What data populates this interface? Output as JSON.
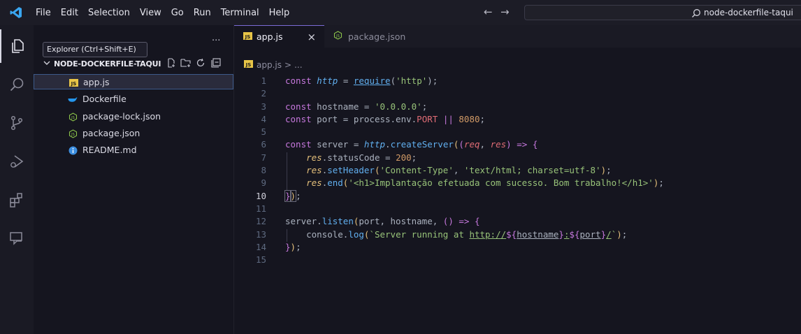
{
  "titlebar": {
    "menu": [
      "File",
      "Edit",
      "Selection",
      "View",
      "Go",
      "Run",
      "Terminal",
      "Help"
    ],
    "back_arrow": "←",
    "forward_arrow": "→",
    "search_text": "node-dockerfile-taqui"
  },
  "tooltip": "Explorer (Ctrl+Shift+E)",
  "sidebar": {
    "more_label": "···",
    "folder_name": "NODE-DOCKERFILE-TAQUI",
    "files": [
      {
        "name": "app.js",
        "icon": "js-icon"
      },
      {
        "name": "Dockerfile",
        "icon": "docker-icon"
      },
      {
        "name": "package-lock.json",
        "icon": "npm-icon"
      },
      {
        "name": "package.json",
        "icon": "npm-icon"
      },
      {
        "name": "README.md",
        "icon": "info-icon"
      }
    ]
  },
  "tabs": [
    {
      "label": "app.js",
      "badge": "JS",
      "close": "×"
    },
    {
      "label": "package.json",
      "badge": "⬡"
    }
  ],
  "breadcrumb": {
    "file": "app.js",
    "sep": ">",
    "rest": "..."
  },
  "editor": {
    "current_line": 10,
    "lines": [
      "const http = require('http');",
      "",
      "const hostname = '0.0.0.0';",
      "const port = process.env.PORT || 8080;",
      "",
      "const server = http.createServer((req, res) => {",
      "    res.statusCode = 200;",
      "    res.setHeader('Content-Type', 'text/html; charset=utf-8');",
      "    res.end('<h1>Implantação efetuada com sucesso. Bom trabalho!</h1>');",
      "});",
      "",
      "server.listen(port, hostname, () => {",
      "    console.log(`Server running at http://${hostname}:${port}/`);",
      "});",
      ""
    ],
    "line_numbers": [
      "1",
      "2",
      "3",
      "4",
      "5",
      "6",
      "7",
      "8",
      "9",
      "10",
      "11",
      "12",
      "13",
      "14",
      "15"
    ]
  },
  "colors": {
    "accent": "#7b6bd6",
    "background": "#15151f",
    "keyword": "#c678dd",
    "string": "#98c379",
    "number": "#d19a66",
    "function": "#61afef"
  }
}
